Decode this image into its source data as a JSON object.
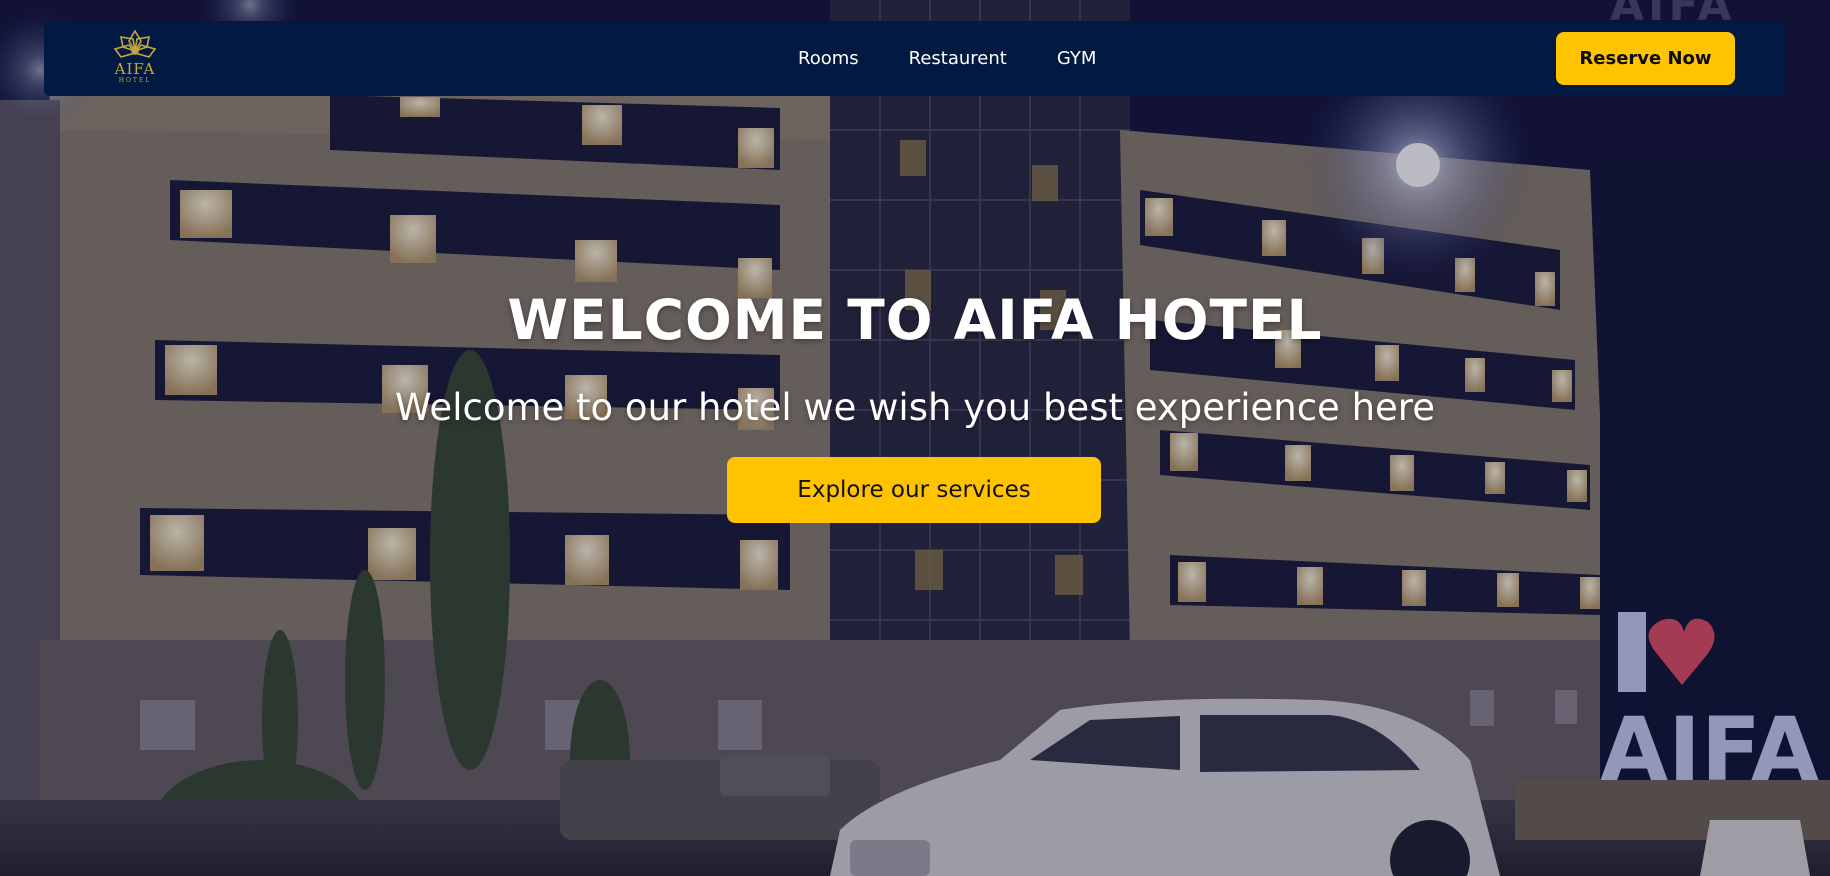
{
  "brand": {
    "name": "AIFA",
    "tagline": "HOTEL",
    "logo_icon": "lotus-icon",
    "color": "#c8a640"
  },
  "nav": {
    "links": [
      "Rooms",
      "Restaurent",
      "GYM"
    ],
    "reserve_label": "Reserve Now"
  },
  "hero": {
    "title": "WELCOME TO AIFA HOTEL",
    "subtitle": "Welcome to our hotel we wish you best experience here",
    "cta_label": "Explore our services"
  },
  "background": {
    "sign_text": "AIFA",
    "rooftop_text": "AIFA"
  },
  "colors": {
    "navbar": "#021a42",
    "accent": "#ffc300",
    "text": "#ffffff"
  }
}
